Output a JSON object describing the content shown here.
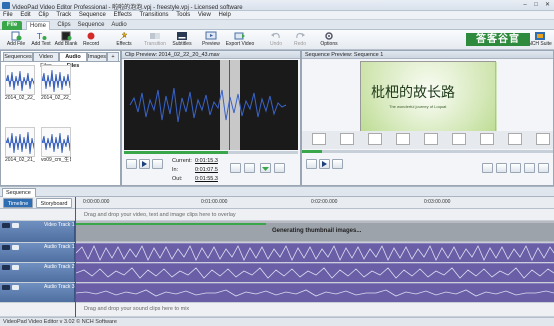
{
  "window": {
    "title": "VideoPad Video Editor Professional - 啦啦的泡泡.vpj - freestyle.vpj - Licensed software",
    "controls": {
      "minimize": "–",
      "maximize": "□",
      "close": "✕"
    }
  },
  "menubar": [
    "File",
    "Edit",
    "Clip",
    "Track",
    "Sequence",
    "Effects",
    "Transitions",
    "Tools",
    "View",
    "Help"
  ],
  "ribbon_tabs": {
    "file": "File",
    "home": "Home",
    "clips": "Clips",
    "sequence": "Sequence",
    "audio": "Audio"
  },
  "toolbar": {
    "add_file": "Add File",
    "add_text": "Add Text",
    "add_blank": "Add Blank",
    "record": "Record",
    "effects": "Effects",
    "transition": "Transition",
    "subtitles": "Subtitles",
    "preview": "Preview",
    "export_video": "Export Video",
    "undo": "Undo",
    "redo": "Redo",
    "options": "Options",
    "nch_suite": "NCH Suite",
    "brand": "答客谷官"
  },
  "bins": {
    "tabs": [
      "Sequences",
      "Video Files",
      "Audio Files",
      "Images"
    ],
    "add": "+",
    "clips": [
      {
        "name": "2014_02_22_20_2..."
      },
      {
        "name": "2014_02_22_20_3..."
      },
      {
        "name": "2014_02_21_1..."
      },
      {
        "name": "vo09_cm_生日快乐·油国·国..."
      }
    ]
  },
  "clip_preview": {
    "header": "Clip Preview: 2014_02_22_20_43.mav",
    "current_label": "Current:",
    "current": "0:01:15.3",
    "in_label": "In:",
    "in": "0:01:07.5",
    "out_label": "Out:",
    "out": "0:01:55.3"
  },
  "sequence_preview": {
    "header": "Sequence Preview: Sequence 1",
    "title_art": "枇杷的故长路",
    "subtitle": "The wonderful journey of Loquat"
  },
  "timeline": {
    "seq_tab": "Sequence 1",
    "close": "×",
    "mode_timeline": "Timeline",
    "mode_storyboard": "Storyboard",
    "ticks": [
      "0:00:00.000",
      "0:01:00.000",
      "0:02:00.000",
      "0:03:00.000"
    ],
    "overlay_hint": "Drag and drop your video, text and image clips here to overlay",
    "video_track": "Video Track 1",
    "generating": "Generating thumbnail images...",
    "audio_track_1": "Audio Track 1",
    "audio_track_2": "Audio Track 2",
    "audio_track_3": "Audio Track 3",
    "sound_hint": "Drag and drop your sound clips here to mix"
  },
  "status": "VideoPad Video Editor v 3.02 © NCH Software",
  "colors": {
    "accent": "#3aa64a",
    "track_header": "#5b7caf",
    "audio_clip": "#6a5fa6",
    "waveform": "#2b56b8",
    "playhead": "#e02020"
  }
}
